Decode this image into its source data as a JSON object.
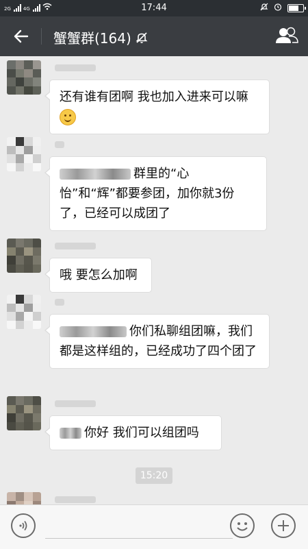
{
  "status_bar": {
    "time": "17:44",
    "network_tags": [
      "2G",
      "4G"
    ],
    "icons": [
      "signal-icon",
      "wifi-icon",
      "mute-icon",
      "alarm-icon",
      "battery-icon"
    ],
    "battery_level": 0.7
  },
  "header": {
    "title": "蟹蟹群(164)",
    "icons": [
      "back-arrow-icon",
      "muted-bell-icon",
      "group-members-icon"
    ]
  },
  "messages": [
    {
      "text": "还有谁有团啊 我也加入进来可以嘛",
      "emoji": "smile-emoji"
    },
    {
      "mention": "@某人",
      "text": "群里的“心怡”和“辉”都要参团，加你就3份了，已经可以成团了"
    },
    {
      "text": "哦 要怎么加啊"
    },
    {
      "mention": "@某人",
      "text": "你们私聊组团嘛，我们都是这样组的，已经成功了四个团了"
    },
    {
      "mention": "@某人",
      "text": "你好 我们可以组团吗"
    }
  ],
  "timestamp": "15:20",
  "input_bar": {
    "icons": [
      "voice-icon",
      "emoji-icon",
      "plus-icon"
    ]
  },
  "colors": {
    "title_bar": "#3a3d41",
    "status_bar": "#2b2f33",
    "chat_bg": "#ebebeb",
    "bubble": "#ffffff"
  }
}
